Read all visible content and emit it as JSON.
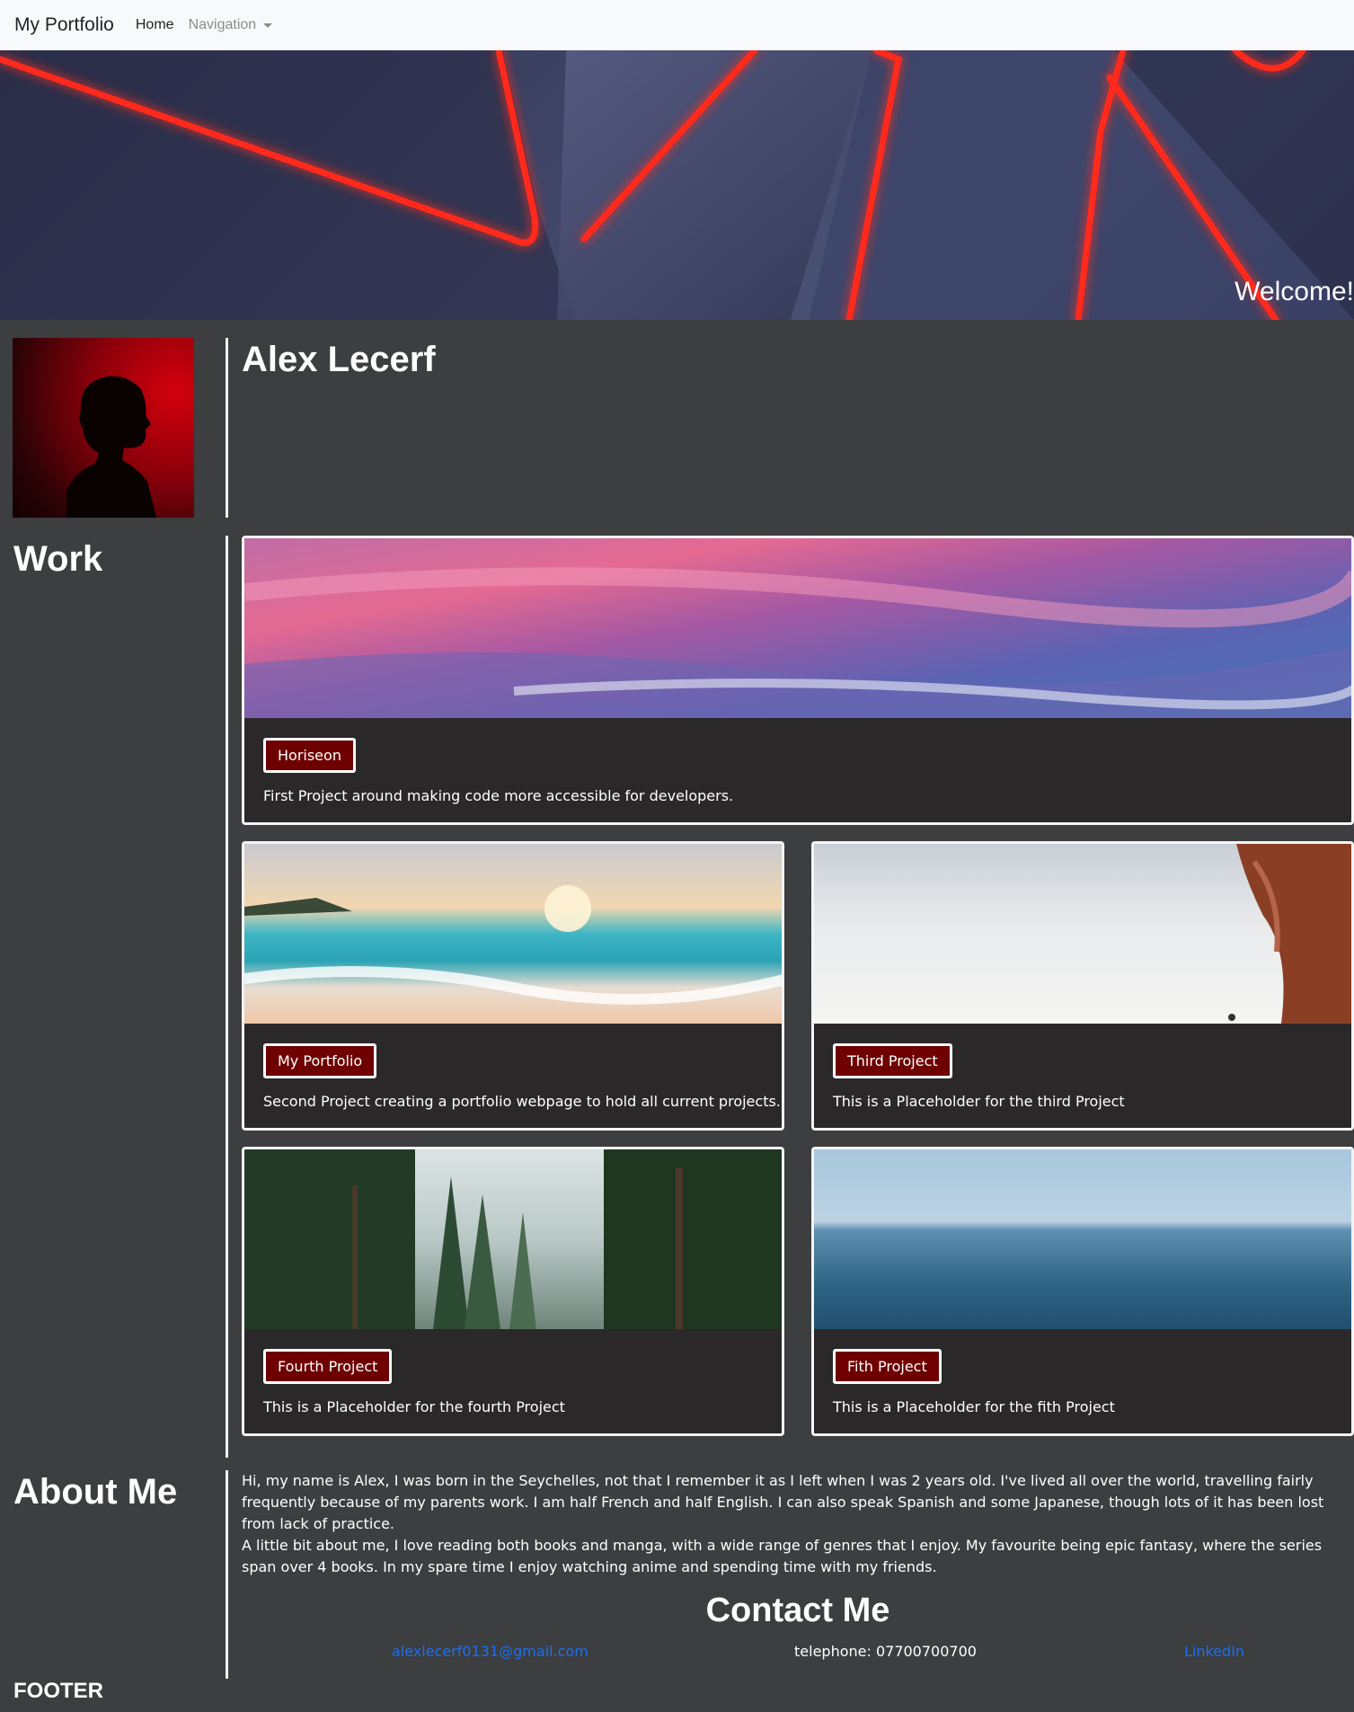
{
  "navbar": {
    "brand": "My Portfolio",
    "links": [
      {
        "label": "Home"
      },
      {
        "label": "Navigation"
      }
    ]
  },
  "hero": {
    "welcome": "Welcome!"
  },
  "profile": {
    "name": "Alex Lecerf"
  },
  "sections": {
    "work": "Work",
    "about": "About Me",
    "footer": "FOOTER"
  },
  "projects": [
    {
      "button": "Horiseon",
      "description": "First Project around making code more accessible for developers."
    },
    {
      "button": "My Portfolio",
      "description": "Second Project creating a portfolio webpage to hold all current projects."
    },
    {
      "button": "Third Project",
      "description": "This is a Placeholder for the third Project"
    },
    {
      "button": "Fourth Project",
      "description": "This is a Placeholder for the fourth Project"
    },
    {
      "button": "Fith Project",
      "description": "This is a Placeholder for the fith Project"
    }
  ],
  "about": {
    "paragraphs": [
      "Hi, my name is Alex, I was born in the Seychelles, not that I remember it as I left when I was 2 years old. I've lived all over the world, travelling fairly frequently because of my parents work. I am half French and half English. I can also speak Spanish and some Japanese, though lots of it has been lost from lack of practice.",
      "A little bit about me, I love reading both books and manga, with a wide range of genres that I enjoy. My favourite being epic fantasy, where the series span over 4 books. In my spare time I enjoy watching anime and spending time with my friends."
    ]
  },
  "contact": {
    "title": "Contact Me",
    "email": "alexlecerf0131@gmail.com",
    "telephone": "telephone: 07700700700",
    "linkedin": "LinkedIn"
  },
  "colors": {
    "background": "#3c3e3f",
    "card_background": "#2b2829",
    "button_background": "#6e0000",
    "link": "#1d6ff0",
    "navbar": "#f8f9fa"
  }
}
